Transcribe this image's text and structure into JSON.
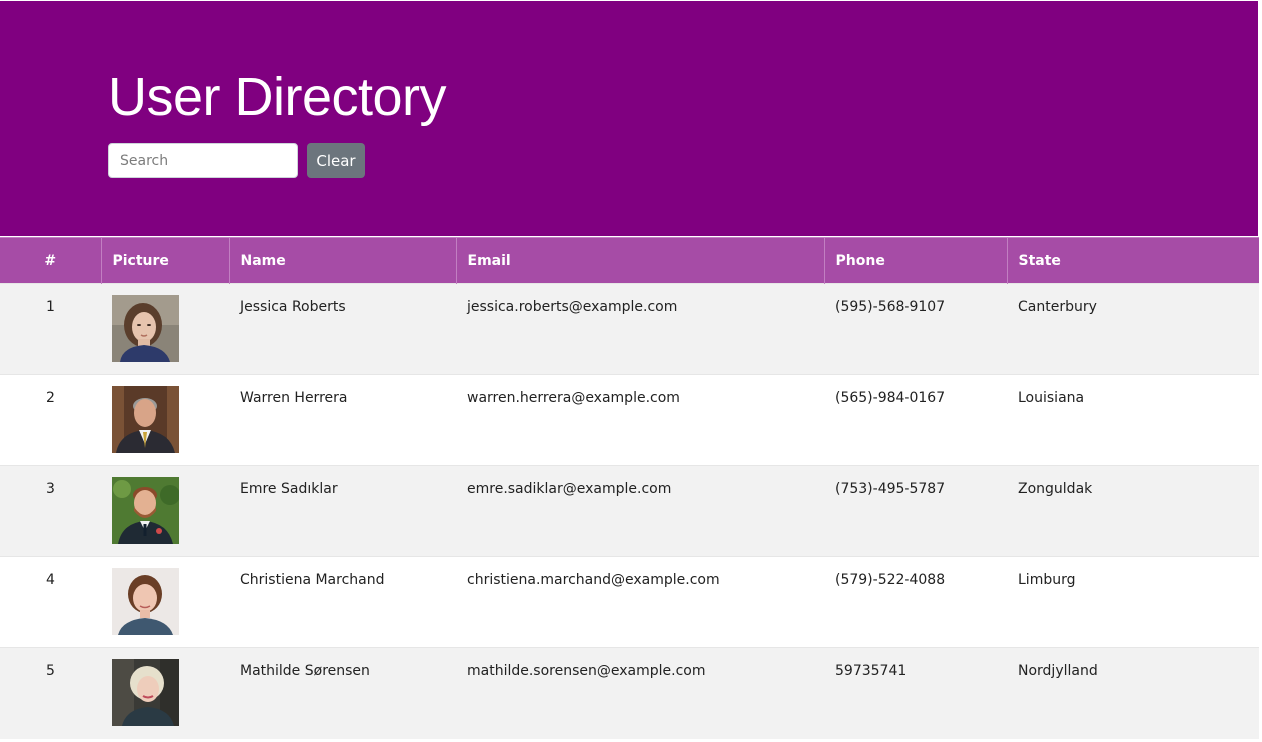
{
  "header": {
    "title": "User Directory",
    "background": "#800080"
  },
  "search": {
    "placeholder": "Search",
    "value": ""
  },
  "clear_button": {
    "label": "Clear"
  },
  "table": {
    "header_color": "#a64ca6",
    "columns": [
      "#",
      "Picture",
      "Name",
      "Email",
      "Phone",
      "State"
    ],
    "rows": [
      {
        "num": "1",
        "name": "Jessica Roberts",
        "email": "jessica.roberts@example.com",
        "phone": "(595)-568-9107",
        "state": "Canterbury",
        "avatar": "avatar-woman-dark-hair"
      },
      {
        "num": "2",
        "name": "Warren Herrera",
        "email": "warren.herrera@example.com",
        "phone": "(565)-984-0167",
        "state": "Louisiana",
        "avatar": "avatar-man-suit"
      },
      {
        "num": "3",
        "name": "Emre Sadıklar",
        "email": "emre.sadiklar@example.com",
        "phone": "(753)-495-5787",
        "state": "Zonguldak",
        "avatar": "avatar-man-beard"
      },
      {
        "num": "4",
        "name": "Christiena Marchand",
        "email": "christiena.marchand@example.com",
        "phone": "(579)-522-4088",
        "state": "Limburg",
        "avatar": "avatar-woman-brown-hair"
      },
      {
        "num": "5",
        "name": "Mathilde Sørensen",
        "email": "mathilde.sorensen@example.com",
        "phone": "59735741",
        "state": "Nordjylland",
        "avatar": "avatar-woman-blonde"
      }
    ]
  }
}
